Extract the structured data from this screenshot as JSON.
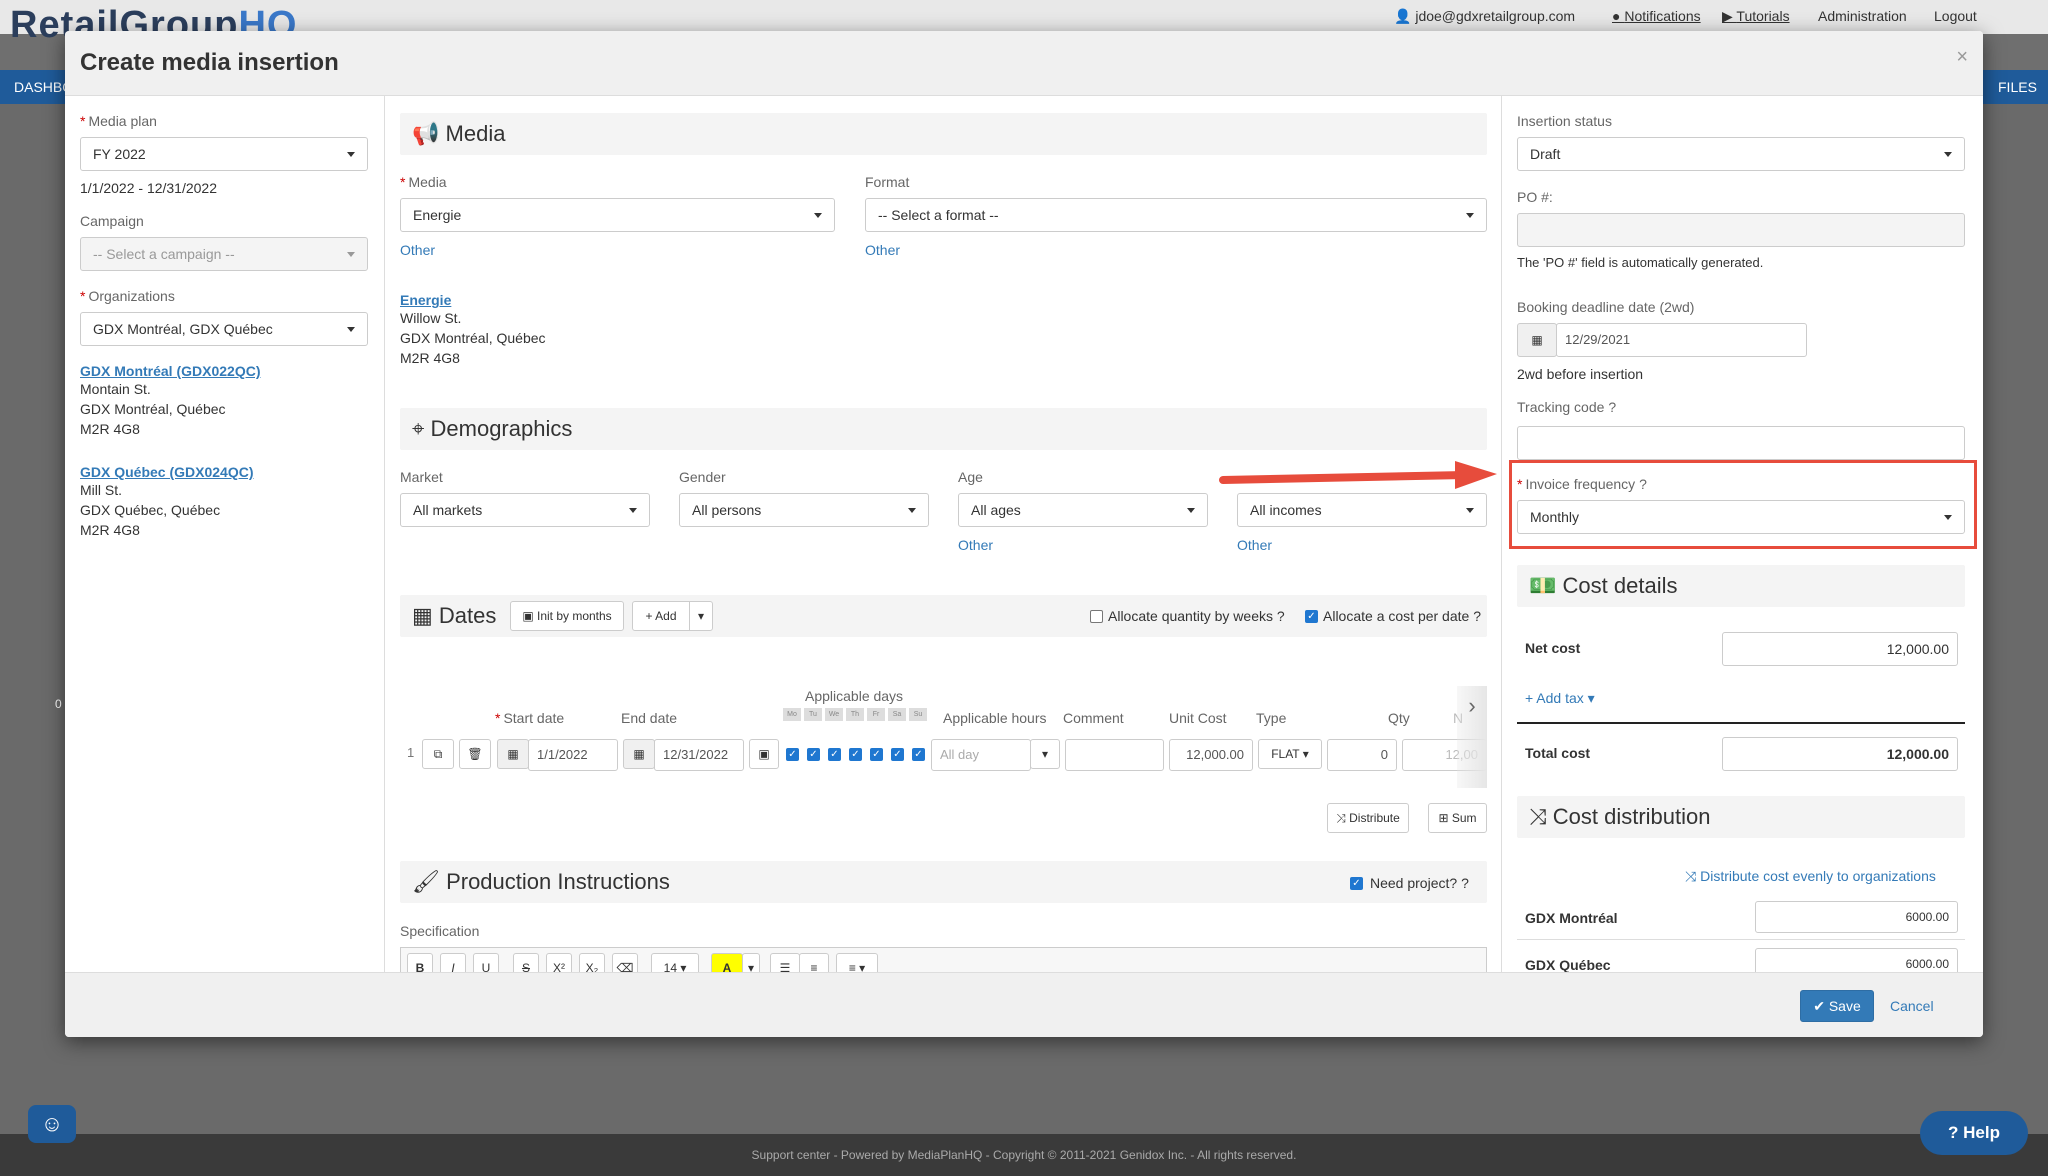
{
  "app": {
    "logo_text": "RetailGroup",
    "logo_hq": "HQ",
    "user_email": "jdoe@gdxretailgroup.com",
    "notifications": "Notifications",
    "tutorials": "Tutorials",
    "administration": "Administration",
    "logout": "Logout",
    "nav_left": "DASHBO",
    "nav_right": "FILES",
    "footer": "Support center - Powered by MediaPlanHQ - Copyright © 2011-2021 Genidox Inc. - All rights reserved.",
    "help": "Help",
    "bg_zero": "0"
  },
  "modal": {
    "title": "Create media insertion",
    "close": "×",
    "save": "Save",
    "cancel": "Cancel"
  },
  "left": {
    "media_plan_label": "Media plan",
    "media_plan_value": "FY 2022",
    "media_plan_dates": "1/1/2022 - 12/31/2022",
    "campaign_label": "Campaign",
    "campaign_value": "-- Select a campaign --",
    "organizations_label": "Organizations",
    "organizations_value": "GDX Montréal, GDX Québec",
    "orgs": [
      {
        "name": "GDX Montréal (GDX022QC)",
        "street": "Montain St.",
        "city": "GDX Montréal, Québec",
        "postal": "M2R 4G8"
      },
      {
        "name": "GDX Québec (GDX024QC)",
        "street": "Mill St.",
        "city": "GDX Québec, Québec",
        "postal": "M2R 4G8"
      }
    ]
  },
  "media": {
    "section": "Media",
    "media_label": "Media",
    "media_value": "Energie",
    "media_other": "Other",
    "format_label": "Format",
    "format_value": "-- Select a format --",
    "format_other": "Other",
    "vendor_name": "Energie",
    "vendor_street": "Willow St.",
    "vendor_city": "GDX Montréal, Québec",
    "vendor_postal": "M2R 4G8"
  },
  "demographics": {
    "section": "Demographics",
    "market_label": "Market",
    "market_value": "All markets",
    "gender_label": "Gender",
    "gender_value": "All persons",
    "age_label": "Age",
    "age_value": "All ages",
    "age_other": "Other",
    "income_value": "All incomes",
    "income_other": "Other"
  },
  "dates": {
    "section": "Dates",
    "init_btn": "Init by months",
    "add_btn": "Add",
    "alloc_qty": "Allocate quantity by weeks",
    "alloc_cost": "Allocate a cost per date",
    "applicable_days": "Applicable days",
    "days": [
      "Mo",
      "Tu",
      "We",
      "Th",
      "Fr",
      "Sa",
      "Su"
    ],
    "headers": {
      "start": "Start date",
      "end": "End date",
      "hours": "Applicable hours",
      "comment": "Comment",
      "unit_cost": "Unit Cost",
      "type": "Type",
      "qty": "Qty",
      "more": "N"
    },
    "row": {
      "num": "1",
      "start": "1/1/2022",
      "end": "12/31/2022",
      "hours": "All day",
      "unit_cost": "12,000.00",
      "type": "FLAT",
      "qty": "0",
      "more": "12,00"
    },
    "distribute": "Distribute",
    "sum": "Sum"
  },
  "production": {
    "section": "Production Instructions",
    "need_project": "Need project?",
    "spec_label": "Specification",
    "font_size": "14"
  },
  "right": {
    "status_label": "Insertion status",
    "status_value": "Draft",
    "po_label": "PO #:",
    "po_note": "The 'PO #' field is automatically generated.",
    "booking_label": "Booking deadline date (2wd)",
    "booking_value": "12/29/2021",
    "booking_note": "2wd before insertion",
    "tracking_label": "Tracking code",
    "invoice_label": "Invoice frequency",
    "invoice_value": "Monthly",
    "cost_section": "Cost details",
    "net_cost_label": "Net cost",
    "net_cost_value": "12,000.00",
    "add_tax": "Add tax",
    "total_cost_label": "Total cost",
    "total_cost_value": "12,000.00",
    "dist_section": "Cost distribution",
    "dist_link": "Distribute cost evenly to organizations",
    "dist_rows": [
      {
        "org": "GDX Montréal",
        "value": "6000.00"
      },
      {
        "org": "GDX Québec",
        "value": "6000.00"
      }
    ]
  },
  "colors": {
    "accent": "#337ab7",
    "highlight": "#e74c3c",
    "save": "#337ab7"
  }
}
